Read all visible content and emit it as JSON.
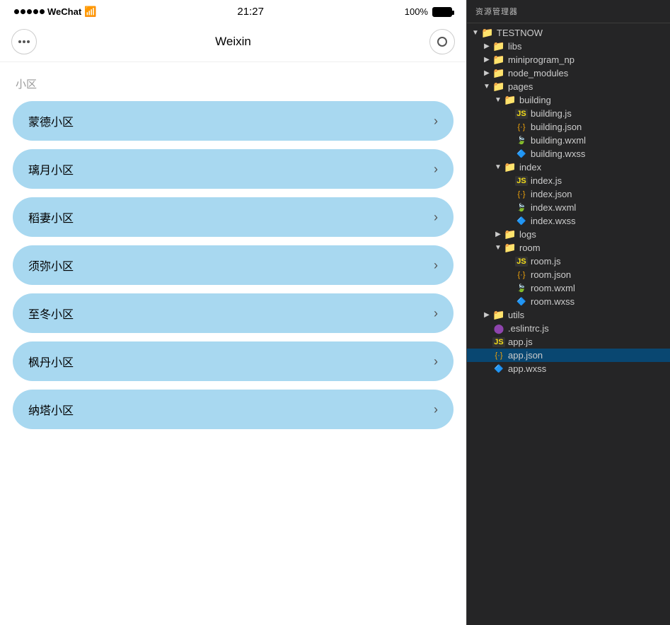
{
  "statusBar": {
    "signal": "●●●●●",
    "carrier": "WeChat",
    "wifi": "WiFi",
    "time": "21:27",
    "battery": "100%"
  },
  "navBar": {
    "title": "Weixin",
    "moreLabel": "···",
    "recordLabel": "⊙"
  },
  "sectionTitle": "小区",
  "listItems": [
    {
      "label": "蒙德小区"
    },
    {
      "label": "璃月小区"
    },
    {
      "label": "稻妻小区"
    },
    {
      "label": "须弥小区"
    },
    {
      "label": "至冬小区"
    },
    {
      "label": "枫丹小区"
    },
    {
      "label": "纳塔小区"
    }
  ],
  "fileTree": {
    "panelTitle": "资源管理器",
    "rootName": "TESTNOW",
    "nodes": [
      {
        "id": "libs",
        "label": "libs",
        "type": "folder-green",
        "indent": 1,
        "expanded": false,
        "arrow": "▶"
      },
      {
        "id": "miniprogram_np",
        "label": "miniprogram_np",
        "type": "folder-green",
        "indent": 1,
        "expanded": false,
        "arrow": "▶"
      },
      {
        "id": "node_modules",
        "label": "node_modules",
        "type": "folder-green",
        "indent": 1,
        "expanded": false,
        "arrow": "▶"
      },
      {
        "id": "pages",
        "label": "pages",
        "type": "folder-red",
        "indent": 1,
        "expanded": true,
        "arrow": "▼"
      },
      {
        "id": "building",
        "label": "building",
        "type": "folder-plain",
        "indent": 2,
        "expanded": true,
        "arrow": "▼"
      },
      {
        "id": "building.js",
        "label": "building.js",
        "type": "js",
        "indent": 3,
        "arrow": ""
      },
      {
        "id": "building.json",
        "label": "building.json",
        "type": "json",
        "indent": 3,
        "arrow": ""
      },
      {
        "id": "building.wxml",
        "label": "building.wxml",
        "type": "wxml",
        "indent": 3,
        "arrow": ""
      },
      {
        "id": "building.wxss",
        "label": "building.wxss",
        "type": "wxss",
        "indent": 3,
        "arrow": ""
      },
      {
        "id": "index",
        "label": "index",
        "type": "folder-plain",
        "indent": 2,
        "expanded": true,
        "arrow": "▼"
      },
      {
        "id": "index.js",
        "label": "index.js",
        "type": "js",
        "indent": 3,
        "arrow": ""
      },
      {
        "id": "index.json",
        "label": "index.json",
        "type": "json",
        "indent": 3,
        "arrow": ""
      },
      {
        "id": "index.wxml",
        "label": "index.wxml",
        "type": "wxml",
        "indent": 3,
        "arrow": ""
      },
      {
        "id": "index.wxss",
        "label": "index.wxss",
        "type": "wxss",
        "indent": 3,
        "arrow": ""
      },
      {
        "id": "logs",
        "label": "logs",
        "type": "folder-plain",
        "indent": 2,
        "expanded": false,
        "arrow": "▶"
      },
      {
        "id": "room",
        "label": "room",
        "type": "folder-plain",
        "indent": 2,
        "expanded": true,
        "arrow": "▼"
      },
      {
        "id": "room.js",
        "label": "room.js",
        "type": "js",
        "indent": 3,
        "arrow": ""
      },
      {
        "id": "room.json",
        "label": "room.json",
        "type": "json",
        "indent": 3,
        "arrow": ""
      },
      {
        "id": "room.wxml",
        "label": "room.wxml",
        "type": "wxml",
        "indent": 3,
        "arrow": ""
      },
      {
        "id": "room.wxss",
        "label": "room.wxss",
        "type": "wxss",
        "indent": 3,
        "arrow": ""
      },
      {
        "id": "utils",
        "label": "utils",
        "type": "folder-green",
        "indent": 1,
        "expanded": false,
        "arrow": "▶"
      },
      {
        "id": ".eslintrc.js",
        "label": ".eslintrc.js",
        "type": "eslint",
        "indent": 1,
        "arrow": ""
      },
      {
        "id": "app.js",
        "label": "app.js",
        "type": "js",
        "indent": 1,
        "arrow": ""
      },
      {
        "id": "app.json",
        "label": "app.json",
        "type": "json",
        "indent": 1,
        "arrow": "",
        "selected": true
      },
      {
        "id": "app.wxss",
        "label": "app.wxss",
        "type": "wxss",
        "indent": 1,
        "arrow": ""
      }
    ]
  }
}
